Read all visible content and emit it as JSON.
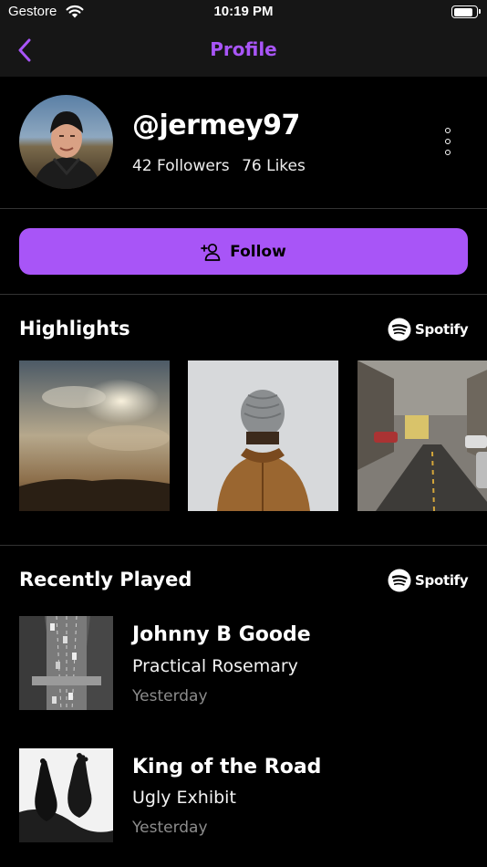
{
  "status_bar": {
    "carrier": "Gestore",
    "time": "10:19 PM",
    "battery_level": 0.9
  },
  "nav": {
    "title": "Profile",
    "back_icon": "chevron-left-icon",
    "accent_color": "#A855F7"
  },
  "profile": {
    "username": "@jermey97",
    "followers": "42 Followers",
    "likes": "76 Likes"
  },
  "follow_button": {
    "label": "Follow",
    "icon": "add-user-icon",
    "color": "#A855F7"
  },
  "highlights": {
    "title": "Highlights",
    "provider": "Spotify",
    "items": [
      {
        "image": "cloudy-sky-desert"
      },
      {
        "image": "person-in-beanie"
      },
      {
        "image": "city-street-traffic"
      }
    ]
  },
  "recently_played": {
    "title": "Recently Played",
    "provider": "Spotify",
    "tracks": [
      {
        "title": "Johnny B Goode",
        "artist": "Practical Rosemary",
        "time": "Yesterday",
        "image": "aerial-highway"
      },
      {
        "title": "King of the Road",
        "artist": "Ugly Exhibit",
        "time": "Yesterday",
        "image": "bare-feet"
      }
    ]
  }
}
